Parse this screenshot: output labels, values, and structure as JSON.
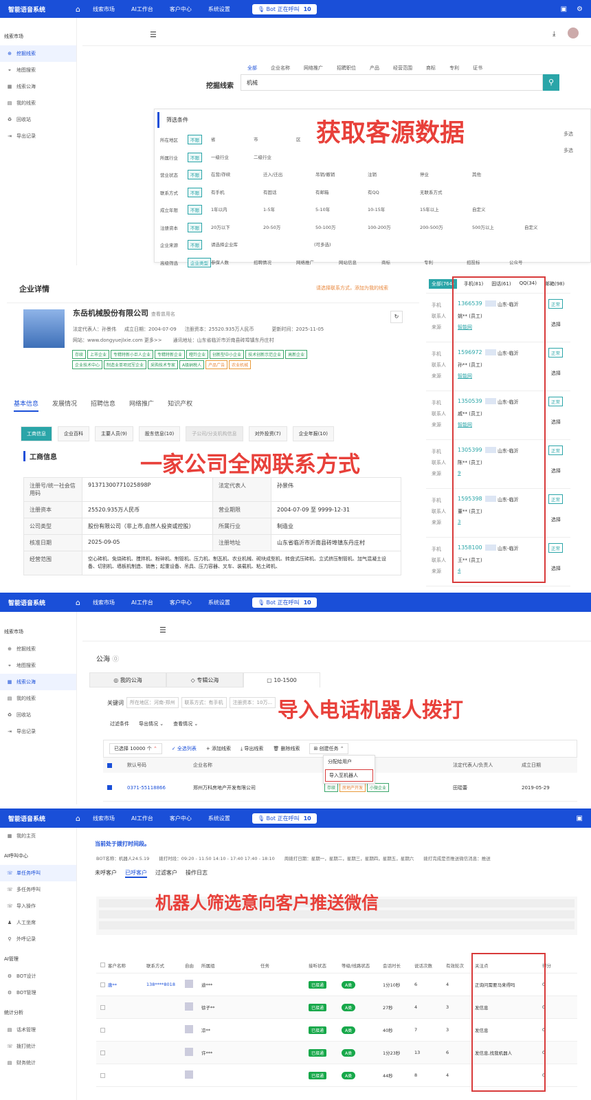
{
  "overlays": {
    "s1": "获取客源数据",
    "s2": "一家公司全网联系方式",
    "s3": "导入电话机器人拨打",
    "s4": "机器人筛选意向客户推送微信"
  },
  "common": {
    "brand": "智能语音系统",
    "nav": [
      "线索市场",
      "AI工作台",
      "客户中心",
      "系统设置"
    ],
    "bot_label": "Bot 正在呼叫",
    "bot_count": "10"
  },
  "s1": {
    "side_title": "线索市场",
    "side": [
      "挖掘线索",
      "地图搜索",
      "线索公海",
      "我的线索",
      "回收站",
      "导出记录"
    ],
    "tabs": [
      "全部",
      "企业名称",
      "网络推广",
      "招聘职位",
      "产品",
      "经营范围",
      "商标",
      "专利",
      "证书"
    ],
    "dig_label": "挖掘线索",
    "search_value": "机械",
    "filter_title": "筛选条件",
    "filters": [
      {
        "label": "所在地区",
        "opts": [
          "不限",
          "省",
          "市",
          "区"
        ]
      },
      {
        "label": "所属行业",
        "opts": [
          "不限",
          "一级行业",
          "二级行业"
        ]
      },
      {
        "label": "营业状态",
        "opts": [
          "不限",
          "在营/存续",
          "迁入/迁出",
          "吊销/撤销",
          "注销",
          "停业",
          "其他"
        ]
      },
      {
        "label": "联系方式",
        "opts": [
          "不限",
          "有手机",
          "有固话",
          "有邮箱",
          "有QQ",
          "无联系方式"
        ]
      },
      {
        "label": "成立年限",
        "opts": [
          "不限",
          "1年以内",
          "1-5年",
          "5-10年",
          "10-15年",
          "15年以上",
          "自定义"
        ]
      },
      {
        "label": "注册资本",
        "opts": [
          "不限",
          "20万以下",
          "20-50万",
          "50-100万",
          "100-200万",
          "200-500万",
          "500万以上",
          "自定义"
        ]
      },
      {
        "label": "企业来源",
        "opts": [
          "不限",
          "请选择企业库",
          "(可多选)"
        ]
      },
      {
        "label": "高级筛选",
        "opts": [
          "企业类型",
          "参保人数",
          "招聘情况",
          "网络推广",
          "网站信息",
          "商标",
          "专利",
          "招投标",
          "公众号"
        ]
      }
    ],
    "right": [
      "多选",
      "多选"
    ]
  },
  "s2": {
    "title": "企业详情",
    "add_link": "请选择联系方式，添加为我的线索",
    "company": "东岳机械股份有限公司",
    "company_link": "查看曾用名",
    "legal": "法定代表人：孙景伟",
    "found": "成立日期：2004-07-09",
    "capital": "注册资本：25520.935万人民币",
    "updated": "更新时间：2025-11-05",
    "site": "网站：www.dongyuejlxie.com 更多>>",
    "addr": "通讯地址：山东省临沂市沂南县砖埠镇东丹庄村",
    "tags": [
      "存续",
      "上市企业",
      "专精特新小巨人企业",
      "专精特新企业",
      "瞪羚企业",
      "创新型中小企业",
      "技术创新示范企业",
      "高新企业",
      "企业技术中心",
      "制造业单项冠军企业",
      "采购技术专家",
      "A级纳税人",
      "产品广告",
      "农业机械"
    ],
    "tabs": [
      "基本信息",
      "发展情况",
      "招聘信息",
      "网络推广",
      "知识产权"
    ],
    "subtabs": [
      "工商信息",
      "企业百科",
      "主要人员(9)",
      "股东信息(10)",
      "子公司/分支机构信息",
      "对外投资(7)",
      "企业年报(10)"
    ],
    "sect": "工商信息",
    "rows": [
      [
        "注册号/统一社会信用码",
        "91371300771025898P",
        "法定代表人",
        "孙景伟"
      ],
      [
        "注册资本",
        "25520.935万人民币",
        "营业期限",
        "2004-07-09 至 9999-12-31"
      ],
      [
        "公司类型",
        "股份有限公司（非上市,自然人投资或控股）",
        "所属行业",
        "制造业"
      ],
      [
        "核准日期",
        "2025-09-05",
        "注册地址",
        "山东省临沂市沂南县砖埠镇东丹庄村"
      ],
      [
        "经营范围",
        "空心砖机、免烧砖机、搅拌机、粉碎机、制管机、压力机、制瓦机、农业机械、砌块成型机、转盘式压砖机、立式挤压制管机、加气混凝土设备、切割机、墙板机制造、销售；起重设备、吊具、压力容器、叉车、装载机、粘土砖机、",
        "",
        ""
      ]
    ],
    "ctabs": [
      "全部(764)",
      "手机(81)",
      "固话(61)",
      "QQ(34)",
      "邮箱(98)"
    ],
    "contacts": [
      {
        "phone": "1366539",
        "loc": "山东-临沂",
        "name": "姚** (员工)",
        "src": "智能网",
        "action": "选择"
      },
      {
        "phone": "1596972",
        "loc": "山东-临沂",
        "name": "孙** (员工)",
        "src": "智能网",
        "action": "选择"
      },
      {
        "phone": "1350539",
        "loc": "山东-临沂",
        "name": "戚** (员工)",
        "src": "智能网",
        "action": "选择"
      },
      {
        "phone": "1305399",
        "loc": "山东-临沂",
        "name": "陈** (员工)",
        "src": "9",
        "action": "选择"
      },
      {
        "phone": "1595398",
        "loc": "山东-临沂",
        "name": "董** (员工)",
        "src": "3",
        "action": "选择"
      },
      {
        "phone": "1358100",
        "loc": "山东-临沂",
        "name": "王** (员工)",
        "src": "4",
        "action": "选择"
      }
    ],
    "clabels": [
      "手机",
      "联系人",
      "来源"
    ],
    "normal": "正常"
  },
  "s3": {
    "side_title": "线索市场",
    "side": [
      "挖掘线索",
      "地图搜索",
      "线索公海",
      "我的线索",
      "回收站",
      "导出记录"
    ],
    "page_title": "公海",
    "tabs": [
      "我的公海",
      "专辑公海",
      "10-1500"
    ],
    "kw_label": "关键词",
    "kw_tags": [
      "所在地区：河南-郑州",
      "联系方式：有手机",
      "注册资本：10万..."
    ],
    "filters": [
      "过滤条件",
      "导出情况",
      "查看情况"
    ],
    "selected": "已选择 10000 个",
    "actions": [
      "全选列表",
      "添加线索",
      "导出线索",
      "删除线索",
      "创建任务"
    ],
    "dropdown": [
      "分配给用户",
      "导入至机器人"
    ],
    "cols": [
      "默认号码",
      "企业名称",
      "企业",
      "法定代表人/负责人",
      "成立日期"
    ],
    "row": {
      "phone": "0371-55118866",
      "name": "郑州万科房地产开发有限公司",
      "legal": "田琨蕾",
      "date": "2019-05-29"
    },
    "rtags": [
      "存续",
      "房地产开发",
      "小微企业"
    ]
  },
  "s4": {
    "side": [
      {
        "t": "我的主页"
      },
      {
        "h": "AI呼叫中心"
      },
      {
        "t": "单任务呼叫",
        "act": true
      },
      {
        "t": "多任务呼叫"
      },
      {
        "t": "导入操作"
      },
      {
        "t": "人工坐席"
      },
      {
        "t": "外呼记录"
      },
      {
        "h": "AI管理"
      },
      {
        "t": "BOT设计"
      },
      {
        "t": "BOT管理"
      },
      {
        "h": "统计分析"
      },
      {
        "t": "话术管理"
      },
      {
        "t": "拨打统计"
      },
      {
        "t": "财务统计"
      }
    ],
    "notice": "当前处于拨打时间段。",
    "info": [
      "BOT名称：机器人24.5.19",
      "拨打时段：09:20 - 11:50 14:10 - 17:40 17:40 - 18:10",
      "周拨打日期：星期一，星期二，星期三，星期四，星期五，星期六",
      "拨打完成是否推送微信消息：推送"
    ],
    "tabs": [
      "未呼客户",
      "已呼客户",
      "过滤客户",
      "操作日志"
    ],
    "cols": [
      "客户名称",
      "联系方式",
      "自由",
      "所属组",
      "任务",
      "接听状态",
      "等级/线路状态",
      "会话时长",
      "说话次数",
      "有效轮次",
      "关注点",
      "得分"
    ],
    "rows": [
      {
        "name": "唐**",
        "phone": "138****8018",
        "grp": "迪***",
        "st": "已接通",
        "lv": "A类",
        "dur": "1分10秒",
        "n1": "6",
        "n2": "4",
        "focus": "正询问需要马来得吗",
        "score": "0"
      },
      {
        "name": "",
        "phone": "",
        "grp": "徐子**",
        "st": "已接通",
        "lv": "A类",
        "dur": "27秒",
        "n1": "4",
        "n2": "3",
        "focus": "发信息",
        "score": "0"
      },
      {
        "name": "",
        "phone": "",
        "grp": "凉**",
        "st": "已接通",
        "lv": "A类",
        "dur": "40秒",
        "n1": "7",
        "n2": "3",
        "focus": "发信息",
        "score": "0"
      },
      {
        "name": "",
        "phone": "",
        "grp": "许***",
        "st": "已接通",
        "lv": "A类",
        "dur": "1分23秒",
        "n1": "13",
        "n2": "6",
        "focus": "发信息,找我机器人",
        "score": "0"
      },
      {
        "name": "",
        "phone": "",
        "grp": "",
        "st": "已接通",
        "lv": "A类",
        "dur": "44秒",
        "n1": "8",
        "n2": "4",
        "focus": "",
        "score": "0"
      }
    ]
  }
}
